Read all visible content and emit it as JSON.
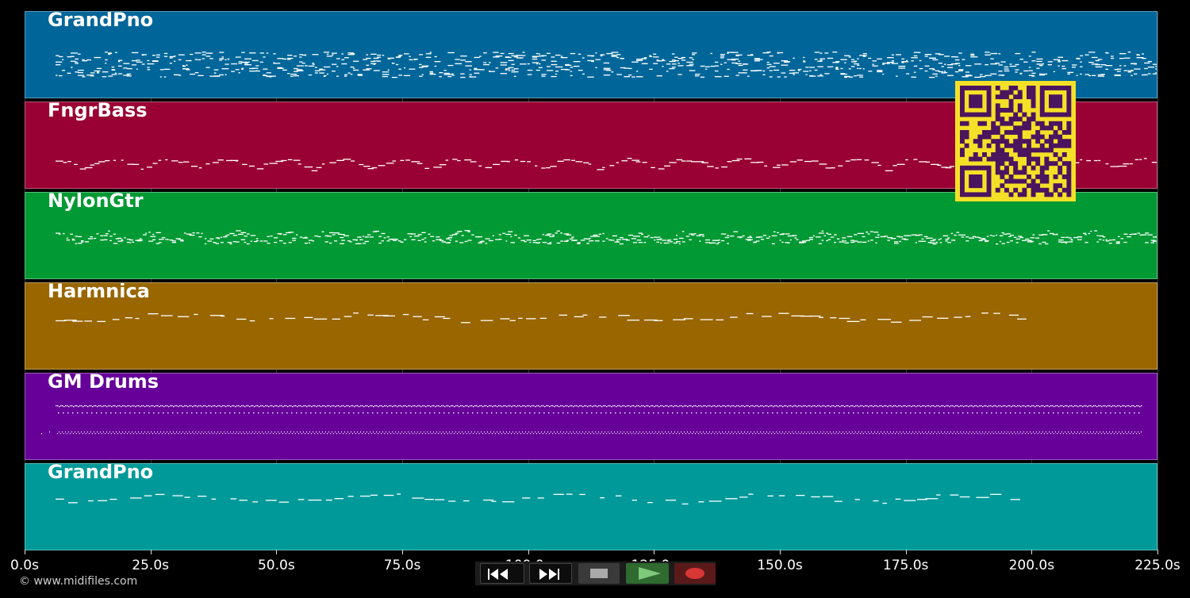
{
  "tracks": [
    {
      "name": "GrandPno",
      "color": "#006699",
      "style": "dense-chords"
    },
    {
      "name": "FngrBass",
      "color": "#990033",
      "style": "bass-line"
    },
    {
      "name": "NylonGtr",
      "color": "#009933",
      "style": "arpeggio"
    },
    {
      "name": "Harmnica",
      "color": "#996600",
      "style": "melody"
    },
    {
      "name": "GM Drums",
      "color": "#660099",
      "style": "drums"
    },
    {
      "name": "GrandPno",
      "color": "#009999",
      "style": "melody"
    }
  ],
  "timeline": {
    "ticks": [
      "0.0s",
      "25.0s",
      "50.0s",
      "75.0s",
      "100.0s",
      "125.0s",
      "150.0s",
      "175.0s",
      "200.0s",
      "225.0s"
    ]
  },
  "transport": {
    "buttons": [
      {
        "name": "rewind-button",
        "icon": "rewind-icon"
      },
      {
        "name": "fast-forward-button",
        "icon": "fast-forward-icon"
      },
      {
        "name": "stop-button",
        "icon": "stop-icon"
      },
      {
        "name": "play-button",
        "icon": "play-icon"
      },
      {
        "name": "record-button",
        "icon": "record-icon"
      }
    ]
  },
  "copyright": "© www.midifiles.com",
  "qr_icon": "qr-code-icon"
}
